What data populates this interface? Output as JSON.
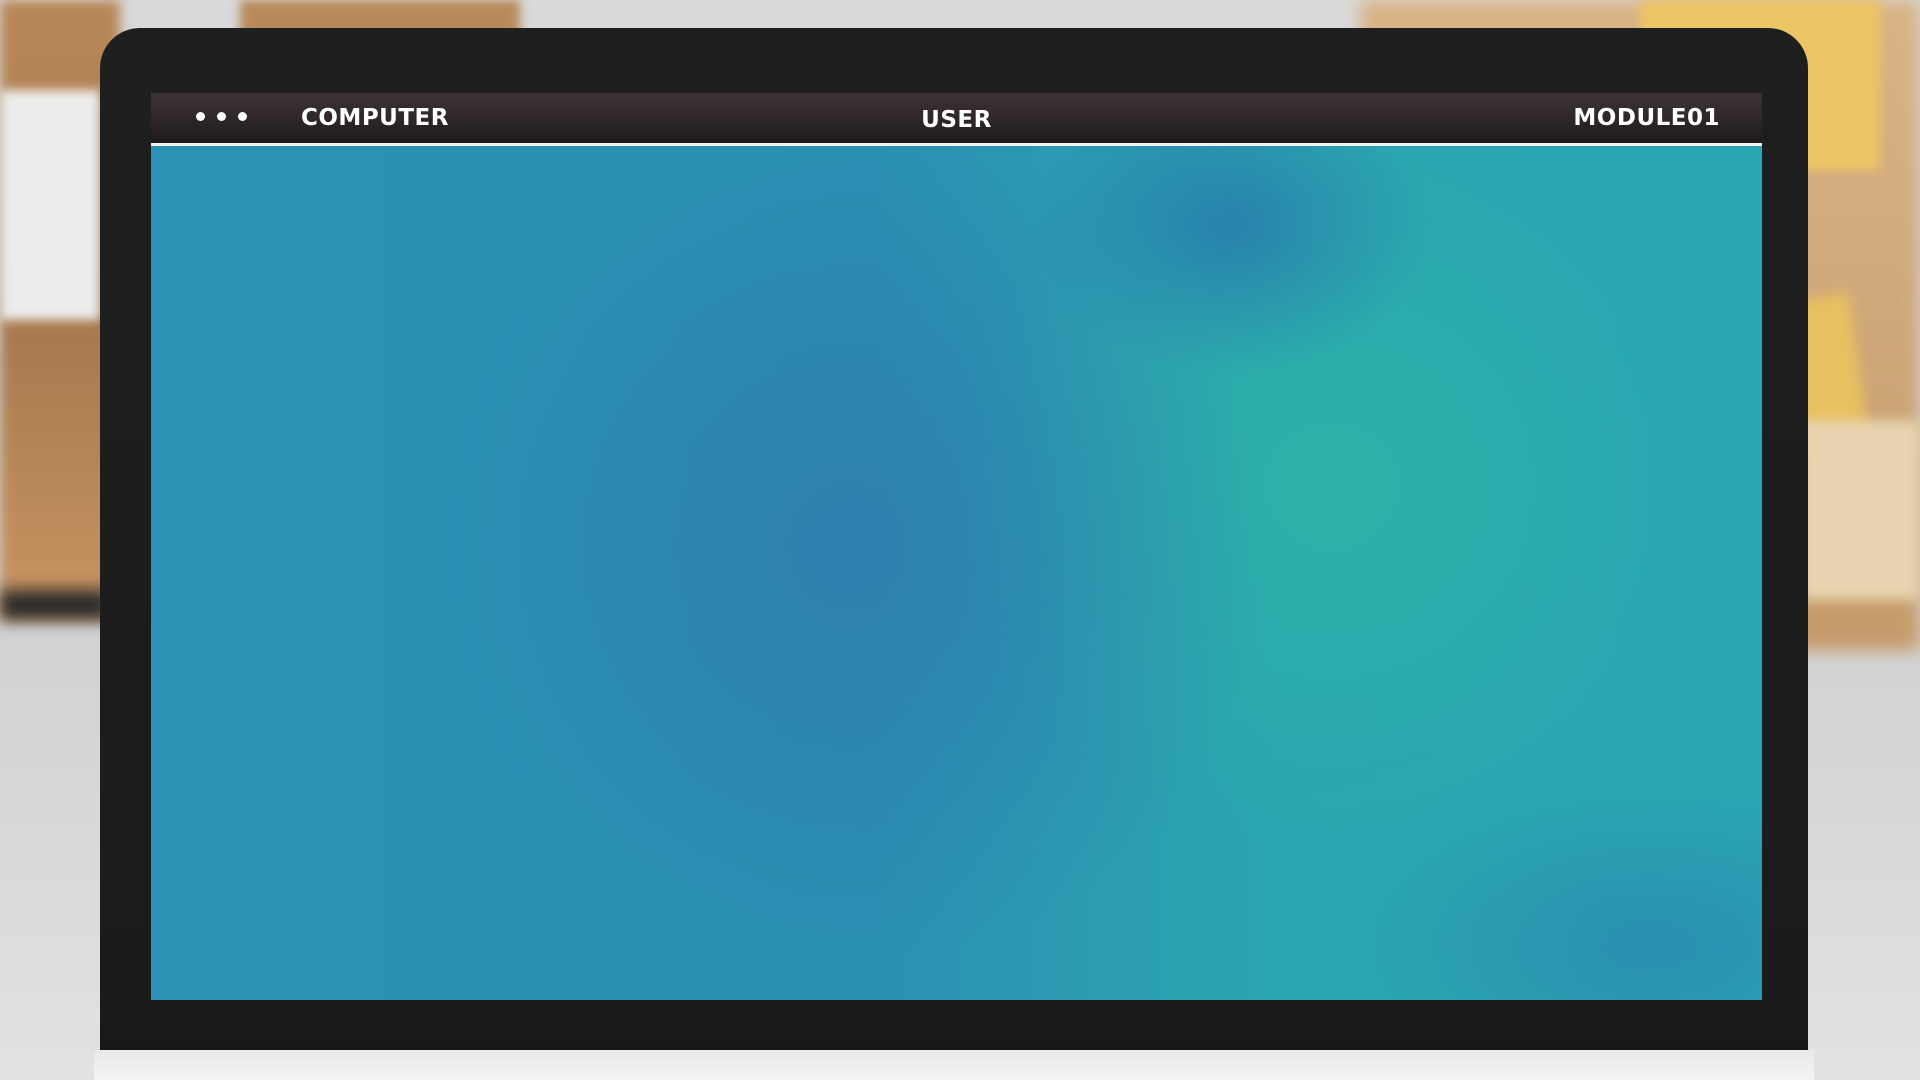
{
  "window": {
    "menu_icon": "three-dots-icon",
    "title_left": "COMPUTER",
    "title_center": "USER",
    "title_right": "MODULE01"
  },
  "colors": {
    "titlebar": "#2f2729",
    "desktop_blue": "#2b8fb2",
    "desktop_teal": "#2cb2a8",
    "bezel": "#1c1c1c"
  }
}
